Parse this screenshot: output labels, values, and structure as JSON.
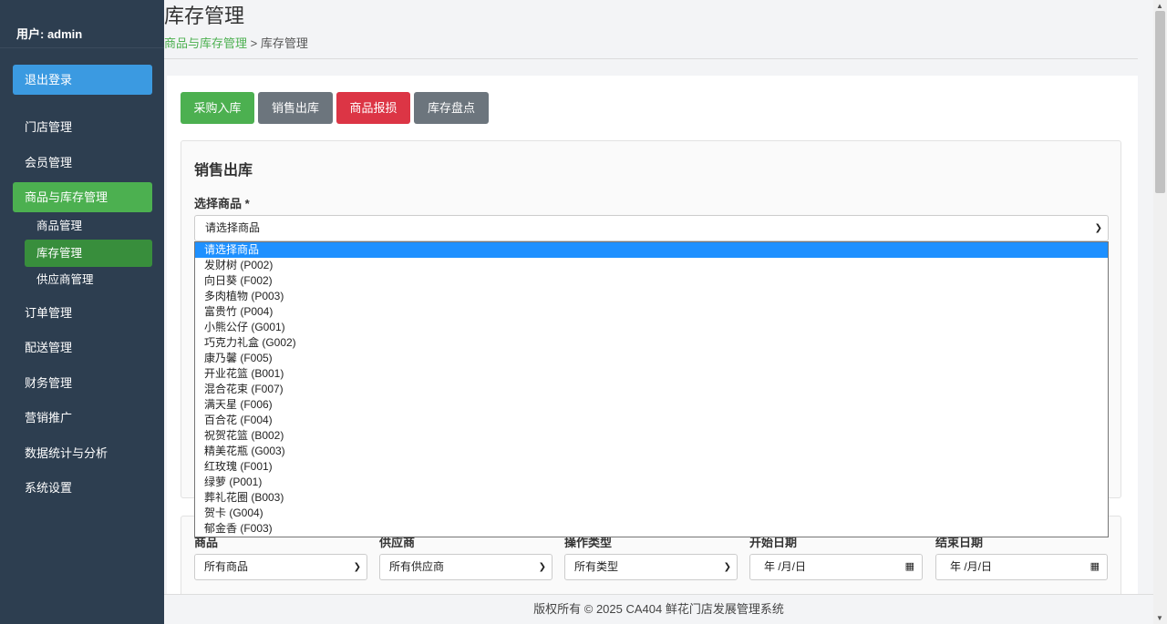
{
  "sidebar": {
    "user": "用户: admin",
    "logout": "退出登录",
    "items": [
      {
        "label": "门店管理"
      },
      {
        "label": "会员管理"
      },
      {
        "label": "商品与库存管理"
      },
      {
        "label": "订单管理"
      },
      {
        "label": "配送管理"
      },
      {
        "label": "财务管理"
      },
      {
        "label": "营销推广"
      },
      {
        "label": "数据统计与分析"
      },
      {
        "label": "系统设置"
      }
    ],
    "subitems": [
      {
        "label": "商品管理"
      },
      {
        "label": "库存管理"
      },
      {
        "label": "供应商管理"
      }
    ]
  },
  "header": {
    "title": "库存管理",
    "breadcrumb_link": "商品与库存管理",
    "breadcrumb_sep": ">",
    "breadcrumb_current": "库存管理"
  },
  "toolbar": {
    "purchase": "采购入库",
    "sales": "销售出库",
    "damage": "商品报损",
    "stocktake": "库存盘点"
  },
  "form": {
    "title": "销售出库",
    "product_label": "选择商品 *",
    "product_value": "请选择商品"
  },
  "dropdown": {
    "options": [
      "请选择商品",
      "发财树 (P002)",
      "向日葵 (F002)",
      "多肉植物 (P003)",
      "富贵竹 (P004)",
      "小熊公仔 (G001)",
      "巧克力礼盒 (G002)",
      "康乃馨 (F005)",
      "开业花篮 (B001)",
      "混合花束 (F007)",
      "满天星 (F006)",
      "百合花 (F004)",
      "祝贺花篮 (B002)",
      "精美花瓶 (G003)",
      "红玫瑰 (F001)",
      "绿萝 (P001)",
      "葬礼花圈 (B003)",
      "贺卡 (G004)",
      "郁金香 (F003)"
    ]
  },
  "filters": {
    "product_label": "商品",
    "product_value": "所有商品",
    "supplier_label": "供应商",
    "supplier_value": "所有供应商",
    "type_label": "操作类型",
    "type_value": "所有类型",
    "start_label": "开始日期",
    "start_value": "年 /月/日",
    "end_label": "结束日期",
    "end_value": "年 /月/日"
  },
  "footer": {
    "text": "版权所有 © 2025 CA404 鲜花门店发展管理系统"
  },
  "colors": {
    "sidebar_bg": "#2d3e50",
    "green": "#4cb050",
    "blue": "#3b9ae1",
    "red": "#dc3545",
    "gray": "#6c757d"
  }
}
